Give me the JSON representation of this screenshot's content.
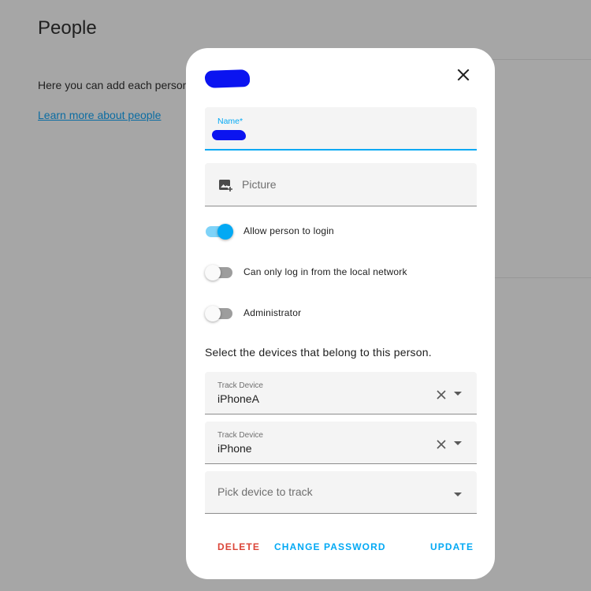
{
  "background": {
    "title": "People",
    "intro": "Here you can add each person",
    "link": "Learn more about people"
  },
  "dialog": {
    "name_field": {
      "label": "Name*"
    },
    "picture_field": {
      "placeholder": "Picture"
    },
    "toggles": [
      {
        "label": "Allow person to login",
        "on": true
      },
      {
        "label": "Can only log in from the local network",
        "on": false
      },
      {
        "label": "Administrator",
        "on": false
      }
    ],
    "devices_prompt": "Select the devices that belong to this person.",
    "devices": [
      {
        "label": "Track Device",
        "value": "iPhoneA"
      },
      {
        "label": "Track Device",
        "value": "iPhone"
      }
    ],
    "pick_device_placeholder": "Pick device to track",
    "actions": {
      "delete": "DELETE",
      "change_password": "CHANGE PASSWORD",
      "update": "UPDATE"
    }
  },
  "colors": {
    "accent": "#03a9f4",
    "danger": "#db4437",
    "overlay": "#a6a6a6",
    "redaction": "#0b14f0"
  },
  "icons": [
    "close-icon",
    "add-photo-icon",
    "clear-icon",
    "dropdown-arrow-icon"
  ]
}
